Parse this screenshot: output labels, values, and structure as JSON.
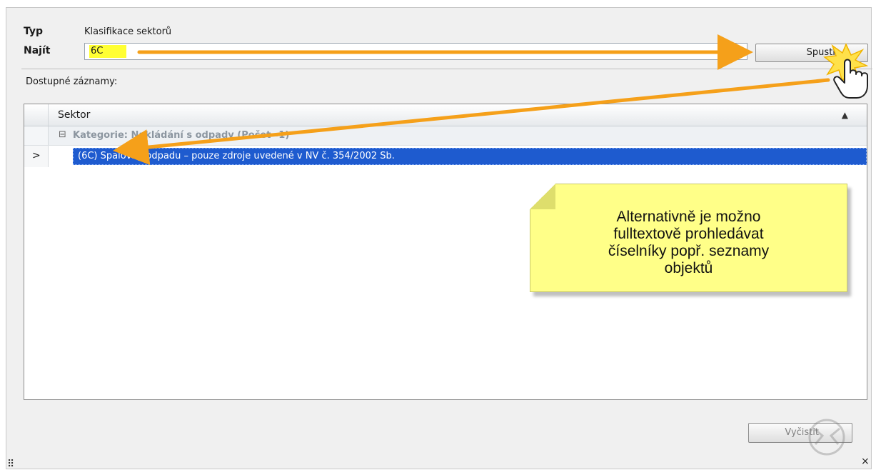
{
  "form": {
    "type_label": "Typ",
    "type_value": "Klasifikace sektorů",
    "find_label": "Najít",
    "find_value": "6C",
    "run_button": "Spustit",
    "available_label": "Dostupné záznamy:"
  },
  "grid": {
    "column_header": "Sektor",
    "sort_icon": "sort-up-icon",
    "group_icon": "collapse-icon",
    "group_label": "Kategorie: Nakládání s odpady (Počet=1)",
    "row_pointer": ">",
    "rows": [
      {
        "text": "(6C) Spalovny odpadu – pouze zdroje uvedené v NV č. 354/2002 Sb."
      }
    ]
  },
  "note": {
    "lines": [
      "Alternativně je možno",
      "fulltextově prohledávat",
      "číselníky popř. seznamy",
      "objektů"
    ]
  },
  "footer": {
    "clear_button": "Vyčistit",
    "close_label": "×",
    "grip_label": "⠿"
  },
  "colors": {
    "highlight": "#ffff33",
    "selection": "#1e5bcf",
    "arrow": "#f5a01a",
    "note": "#ffff88"
  }
}
